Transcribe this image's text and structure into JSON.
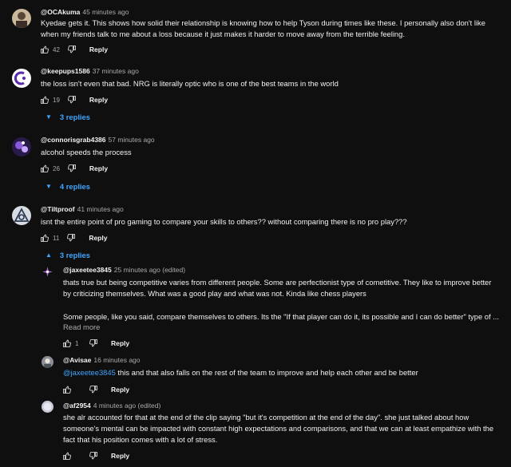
{
  "comments": [
    {
      "handle": "@OCAkuma",
      "time": "45 minutes ago",
      "text_lines": [
        "Kyedae gets it. This shows how solid their relationship is knowing how to help Tyson during times like these. I personally also don't like",
        "when my friends talk to me about a loss because it just makes it harder to move away from the terrible feeling."
      ],
      "likes": "42",
      "reply_label": "Reply"
    },
    {
      "handle": "@keepups1586",
      "time": "37 minutes ago",
      "text": "the loss isn't even that bad. NRG is literally optic who is one of the best teams in the world",
      "likes": "19",
      "reply_label": "Reply",
      "replies_label": "3 replies"
    },
    {
      "handle": "@connorisgrab4386",
      "time": "57 minutes ago",
      "text": "alcohol speeds the process",
      "likes": "26",
      "reply_label": "Reply",
      "replies_label": "4 replies"
    },
    {
      "handle": "@Tiltproof",
      "time": "41 minutes ago",
      "text": "isnt the entire point of pro gaming to compare your skills to others?? without comparing there is no pro play???",
      "likes": "11",
      "reply_label": "Reply",
      "replies_label": "3 replies"
    }
  ],
  "replies": [
    {
      "handle": "@jaxeetee3845",
      "time": "25 minutes ago (edited)",
      "text_lines": [
        "thats true but being competitive varies from different people. Some are perfectionist type of cometitive. They like to improve better",
        "by criticizing themselves. What was a good play and what was not. Kinda like chess players",
        "",
        "Some people, like you said, compare themselves to others. Its the \"If that player can do it, its possible and I can do better\"  type of ..."
      ],
      "read_more": "Read more",
      "likes": "1",
      "reply_label": "Reply"
    },
    {
      "handle": "@Avisae",
      "time": "16 minutes ago",
      "mention": "@jaxeetee3845",
      "text": " this and that also falls on the rest of the team to improve and help each other and be better",
      "likes": "",
      "reply_label": "Reply"
    },
    {
      "handle": "@af2954",
      "time": "4 minutes ago (edited)",
      "text_lines": [
        "she alr accounted for that at the end of the clip saying \"but it's competition at the end of the day\". she just talked about how",
        "someone's mental can be impacted with constant high expectations and comparisons, and that we can at least empathize with the",
        "fact that his position comes with a lot of stress."
      ],
      "likes": "",
      "reply_label": "Reply"
    }
  ],
  "colors": {
    "background": "#0f0f0f",
    "text": "#f1f1f1",
    "secondary": "#aaaaaa",
    "link": "#3ea6ff"
  },
  "icons": [
    "thumbs-up-icon",
    "thumbs-down-icon",
    "caret-down-icon",
    "caret-up-icon"
  ]
}
